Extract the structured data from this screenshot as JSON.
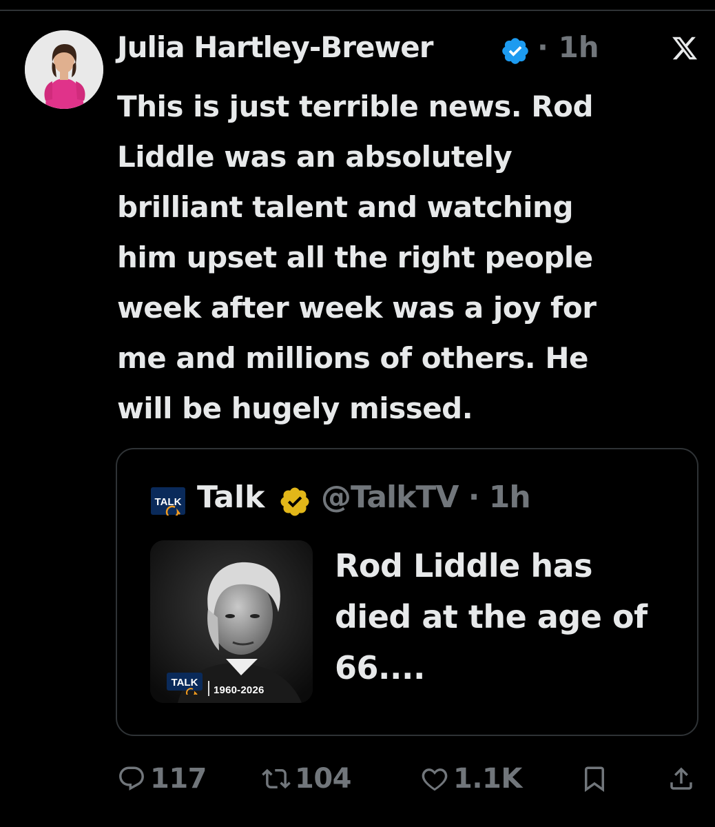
{
  "author": {
    "name": "Julia Hartley-Brewer",
    "time": "· 1h"
  },
  "tweet": {
    "text": "This is just terrible news. Rod\nLiddle was an absolutely\nbrilliant talent and watching\nhim upset all the right people\nweek after week was a joy for\nme and millions of others. He\nwill be hugely missed."
  },
  "quoted": {
    "logo_text": "TALK",
    "name": "Talk",
    "handle_time": "@TalkTV · 1h",
    "image_logo_text": "TALK",
    "image_years": "1960-2026",
    "text": "Rod Liddle has\ndied at the age of\n66...."
  },
  "actions": {
    "replies": "117",
    "reposts": "104",
    "likes": "1.1K"
  },
  "icons": {
    "verified": "verified-blue-badge-icon",
    "gold": "verified-gold-badge-icon",
    "x_logo": "x-logo-icon",
    "reply": "reply-icon",
    "repost": "repost-icon",
    "like": "heart-icon",
    "bookmark": "bookmark-icon",
    "share": "share-icon"
  },
  "colors": {
    "background": "#000000",
    "text": "#e7e9ea",
    "secondary": "#71767b",
    "verified_blue": "#1d9bf0",
    "verified_gold": "#e2b719",
    "border": "#2f3336"
  }
}
